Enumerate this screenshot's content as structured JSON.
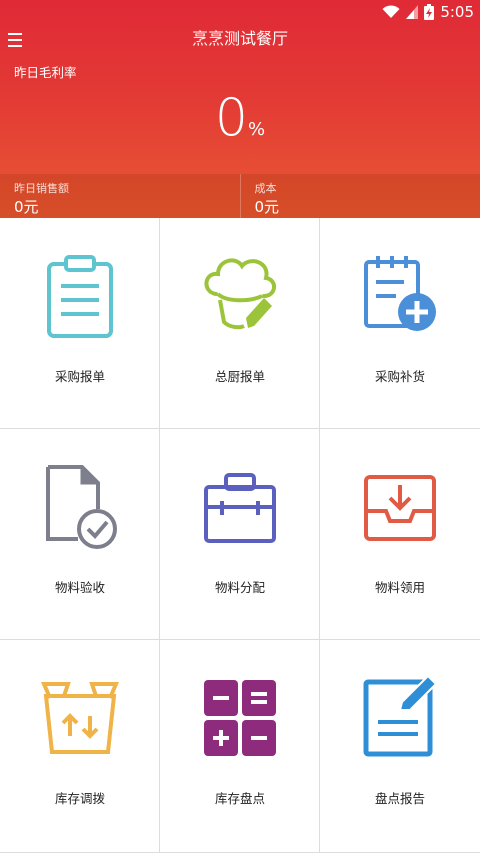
{
  "status_bar": {
    "time": "5:05"
  },
  "header": {
    "title": "烹烹测试餐厅"
  },
  "metric": {
    "label": "昨日毛利率",
    "value": "0",
    "unit": "%"
  },
  "stats": [
    {
      "label": "昨日销售额",
      "value": "0元"
    },
    {
      "label": "成本",
      "value": "0元"
    }
  ],
  "tiles": [
    {
      "label": "采购报单",
      "icon": "clipboard-icon",
      "color": "#5ec4cf"
    },
    {
      "label": "总厨报单",
      "icon": "chef-hat-icon",
      "color": "#9cc43a"
    },
    {
      "label": "采购补货",
      "icon": "notepad-add-icon",
      "color": "#4a8fd8"
    },
    {
      "label": "物料验收",
      "icon": "document-check-icon",
      "color": "#7d7f8c"
    },
    {
      "label": "物料分配",
      "icon": "toolbox-icon",
      "color": "#5b5fbd"
    },
    {
      "label": "物料领用",
      "icon": "inbox-download-icon",
      "color": "#e05a45"
    },
    {
      "label": "库存调拨",
      "icon": "box-transfer-icon",
      "color": "#f0b347"
    },
    {
      "label": "库存盘点",
      "icon": "calculator-icon",
      "color": "#8e2b7c"
    },
    {
      "label": "盘点报告",
      "icon": "report-edit-icon",
      "color": "#2f8fd6"
    }
  ]
}
